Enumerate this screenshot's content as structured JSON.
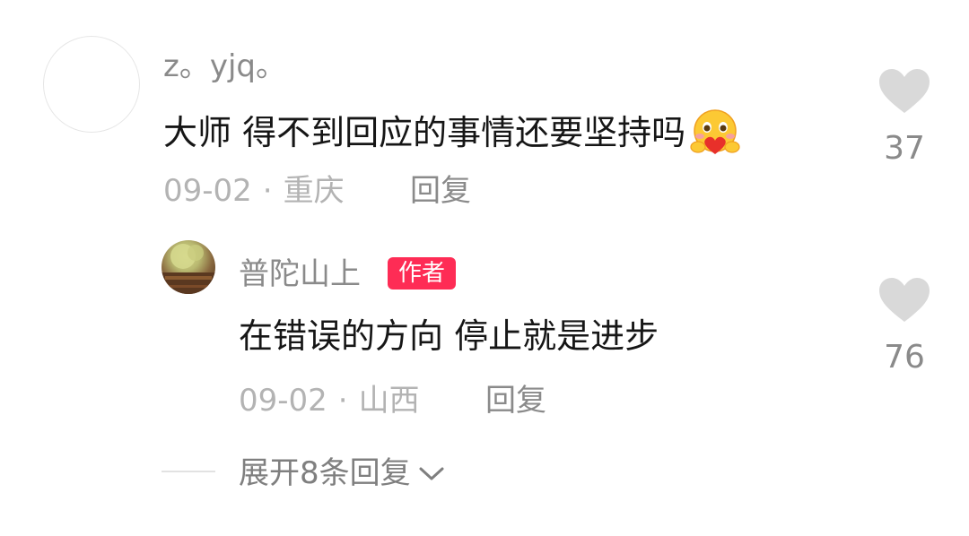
{
  "comment": {
    "username": "z。yjq。",
    "text": "大师 得不到回应的事情还要坚持吗",
    "emoji": "🥰",
    "date": "09-02",
    "separator": "·",
    "location": "重庆",
    "reply_label": "回复",
    "likes": "37"
  },
  "reply": {
    "username": "普陀山上",
    "badge": "作者",
    "text": "在错误的方向 停止就是进步",
    "date": "09-02",
    "separator": "·",
    "location": "山西",
    "reply_label": "回复",
    "likes": "76"
  },
  "expand": {
    "label": "展开8条回复"
  },
  "colors": {
    "badge": "#fe2c55",
    "heart": "#d9d9d9"
  }
}
